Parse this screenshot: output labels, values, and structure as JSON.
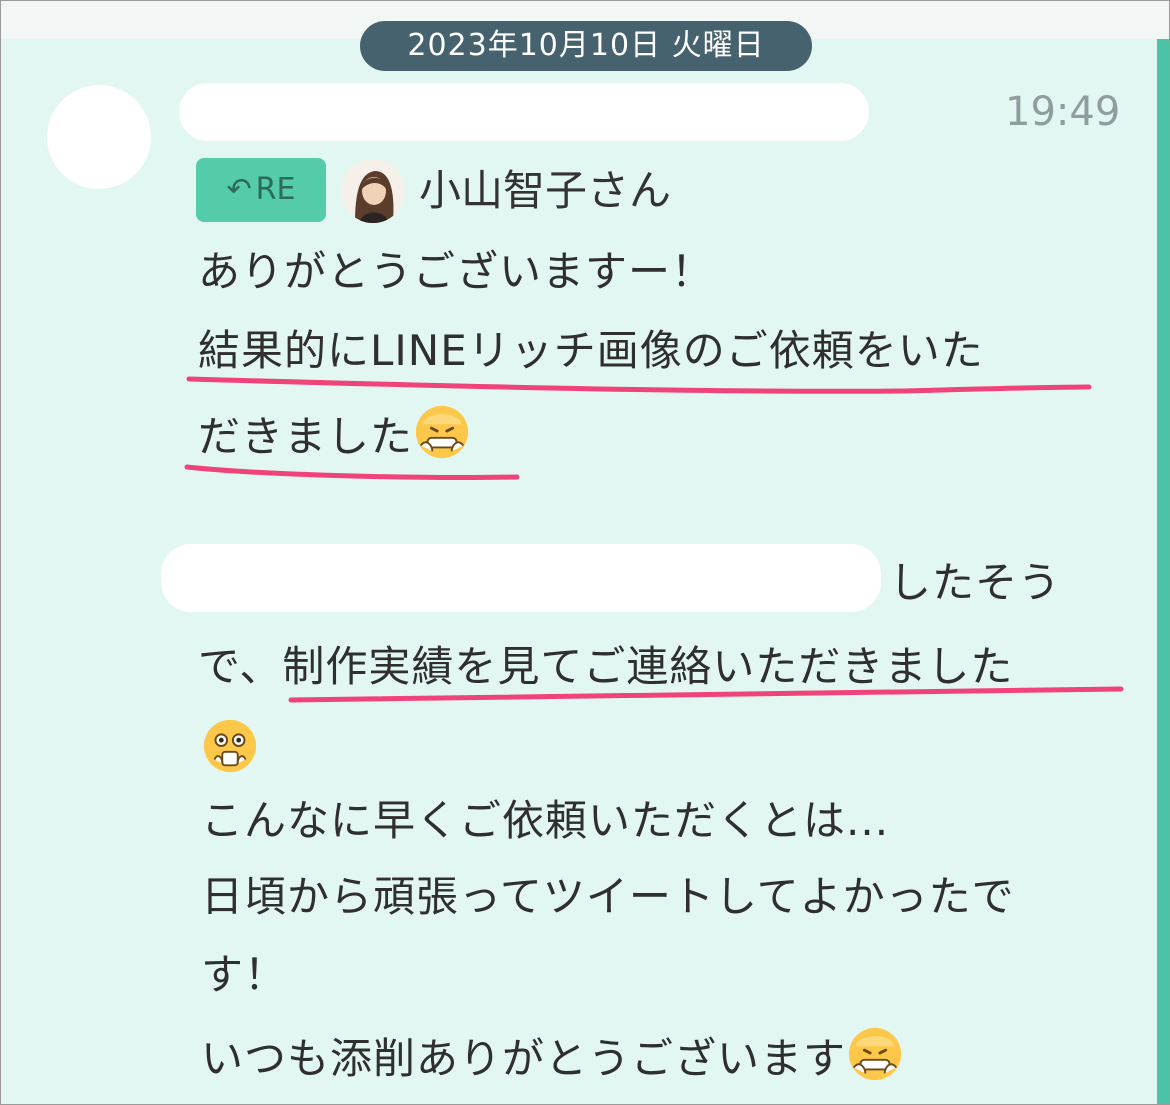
{
  "chat": {
    "date_label": "2023年10月10日 火曜日",
    "time": "19:49",
    "reply_badge": {
      "icon": "reply-arrow-icon",
      "label": "RE"
    },
    "reply_to_name": "小山智子さん",
    "message": {
      "line1": "ありがとうございますー！",
      "line2": "結果的にLINEリッチ画像のご依頼をいた",
      "line3": "だきました",
      "line4_suffix": "したそう",
      "line5_prefix": "で、",
      "line5_highlight": "制作実績を見てご連絡いただきました",
      "line7": "こんなに早くご依頼いただくとは...",
      "line8": "日頃から頑張ってツイートしてよかったで",
      "line9": "す！",
      "line10": "いつも添削ありがとうございます"
    },
    "emojis": [
      "grinning-sweat-emoji",
      "nervous-face-emoji",
      "grinning-sweat-emoji"
    ]
  },
  "colors": {
    "background": "#e3f7f2",
    "date_pill": "#45626e",
    "accent_green": "#4bc3a6",
    "underline": "#f0437a"
  }
}
